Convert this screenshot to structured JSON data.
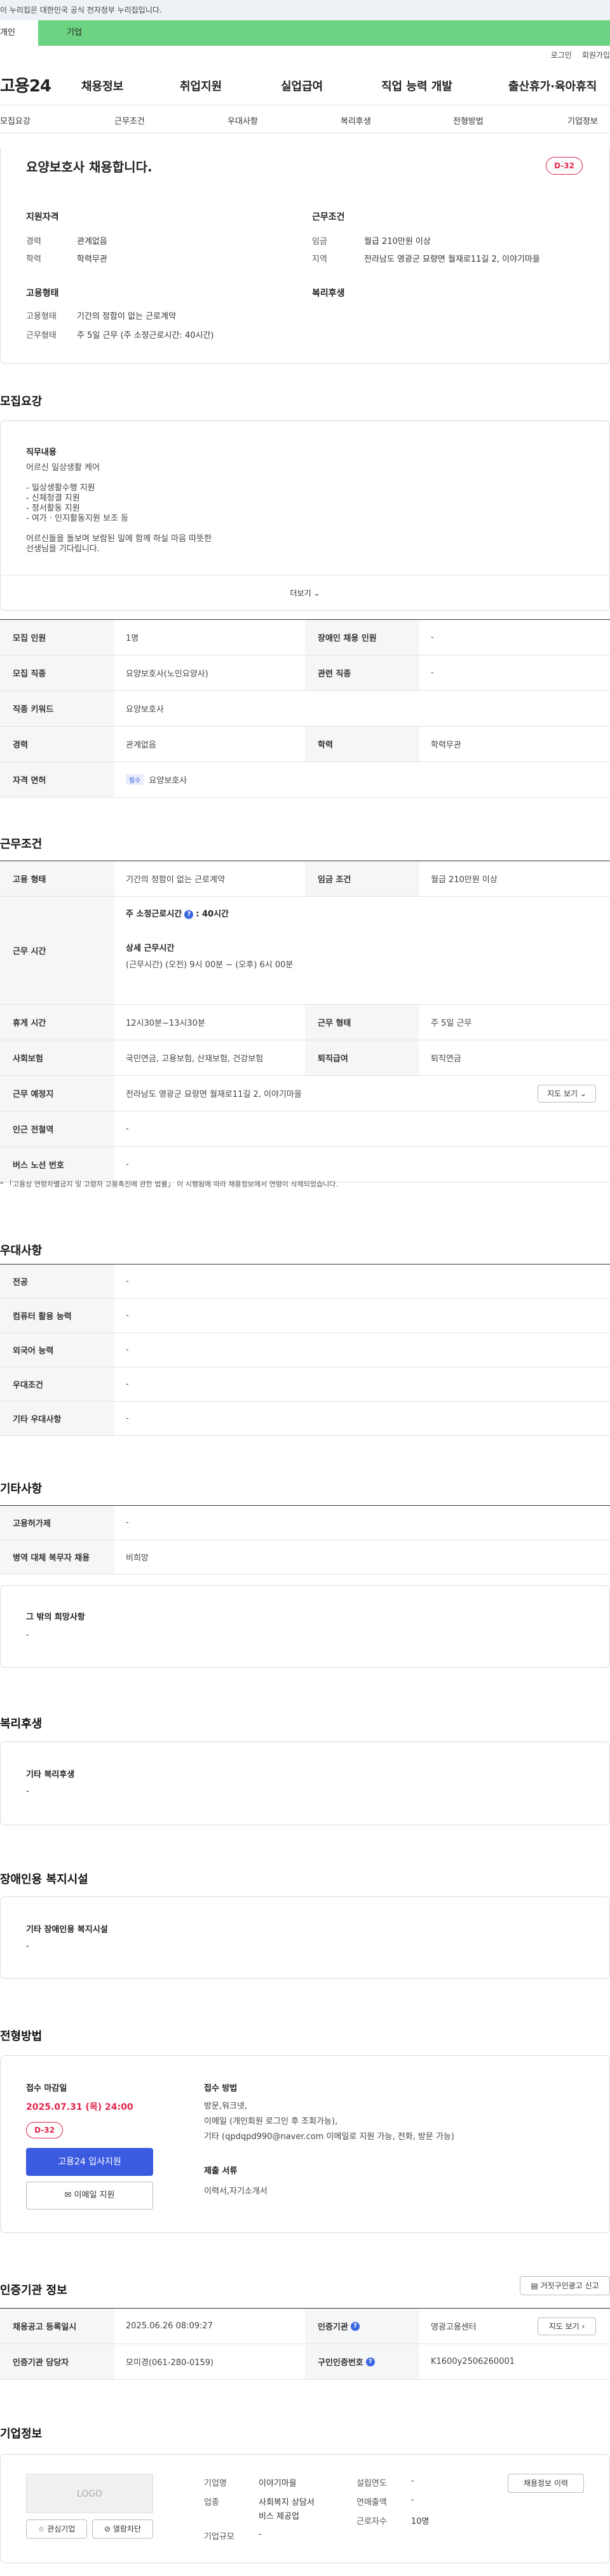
{
  "gov_notice": "이 누리집은 대한민국 공식 전자정부 누리집입니다.",
  "top_tabs": [
    "개인",
    "기업"
  ],
  "util_links": [
    "로그인",
    "회원가입"
  ],
  "logo": "고용24",
  "gnb": [
    "채용정보",
    "취업지원",
    "실업급여",
    "직업 능력 개발",
    "출산휴가·육아휴직"
  ],
  "subnav": [
    "모집요강",
    "근무조건",
    "우대사항",
    "복리후생",
    "전형방법",
    "기업정보"
  ],
  "header": {
    "title": "요양보호사 채용합니다.",
    "dday": "D-32",
    "qual_title": "지원자격",
    "cond_title": "근무조건",
    "career_label": "경력",
    "career_value": "관계없음",
    "edu_label": "학력",
    "edu_value": "학력무관",
    "wage_label": "임금",
    "wage_value": "월급 210만원 이상",
    "region_label": "지역",
    "region_value": "전라남도 영광군 묘량면 월재로11길 2, 이야기마을",
    "emp_title": "고용형태",
    "welfare_title": "복리후생",
    "emptype_label": "고용형태",
    "emptype_value": "기간의 정함이 없는 근로계약",
    "worktype_label": "근무형태",
    "worktype_value": "주 5일 근무 (주 소정근로시간: 40시간)"
  },
  "recruit": {
    "section_title": "모집요강",
    "duty_title": "직무내용",
    "duty_lines": [
      "어르신 일상생활 케어",
      "",
      "- 일상생활수행 지원",
      "- 신체청결 지원",
      "- 정서활동 지원",
      "- 여가 · 인지활동지원 보조 등",
      "",
      "어르신들을 돌보며 보람된 일에 함께 하실 마음 따뜻한",
      "선생님을 기다립니다."
    ],
    "more": "더보기",
    "rows": [
      {
        "th1": "모집 인원",
        "td1": "1명",
        "th2": "장애인 채용 인원",
        "td2": "-"
      },
      {
        "th1": "모집 직종",
        "td1": "요양보호사(노인요양사)",
        "th2": "관련 직종",
        "td2": "-"
      },
      {
        "th1": "직종 키워드",
        "td1": "요양보호사"
      },
      {
        "th1": "경력",
        "td1": "관계없음",
        "th2": "학력",
        "td2": "학력무관"
      },
      {
        "th1": "자격 면허",
        "chip": "필수",
        "td1": "요양보호사"
      }
    ]
  },
  "work": {
    "section_title": "근무조건",
    "emp_th": "고용 형태",
    "emp_td": "기간의 정함이 없는 근로계약",
    "wage_th": "임금 조건",
    "wage_td": "월급 210만원 이상",
    "hours_th": "근무 시간",
    "hours_weekly_label": "주 소정근로시간",
    "hours_weekly_value": ": 40시간",
    "hours_detail_title": "상세 근무시간",
    "hours_detail": "(근무시간) (오전) 9시 00분 ~ (오후) 6시 00분",
    "break_th": "휴게 시간",
    "break_td": "12시30분~13시30분",
    "form_th": "근무 형태",
    "form_td": "주 5일 근무",
    "ins_th": "사회보험",
    "ins_td": "국민연금, 고용보험, 산재보험, 건강보험",
    "sev_th": "퇴직급여",
    "sev_td": "퇴직연금",
    "place_th": "근무 예정지",
    "place_td": "전라남도 영광군 묘량면 월재로11길 2, 이야기마을",
    "map_btn": "지도 보기",
    "subway_th": "인근 전철역",
    "subway_td": "-",
    "bus_th": "버스 노선 번호",
    "bus_td": "-",
    "notice": "* 「고용상 연령차별금지 및 고령자 고용촉진에 관한 법률」 이 시행됨에 따라 채용정보에서 연령이 삭제되었습니다."
  },
  "pref": {
    "section_title": "우대사항",
    "rows": [
      [
        "전공",
        "-"
      ],
      [
        "컴퓨터 활용 능력",
        "-"
      ],
      [
        "외국어 능력",
        "-"
      ],
      [
        "우대조건",
        "-"
      ],
      [
        "기타 우대사항",
        "-"
      ]
    ]
  },
  "etc": {
    "section_title": "기타사항",
    "rows": [
      [
        "고용허가제",
        "-"
      ],
      [
        "병역 대체 복무자 채용",
        "비희망"
      ]
    ],
    "box_title": "그 밖의 희망사항",
    "box_value": "-"
  },
  "welfare": {
    "section_title": "복리후생",
    "box_title": "기타 복리후생",
    "box_value": "-"
  },
  "disabled": {
    "section_title": "장애인용 복지시설",
    "box_title": "기타 장애인용 복지시설",
    "box_value": "-"
  },
  "apply": {
    "section_title": "전형방법",
    "deadline_title": "접수 마감일",
    "deadline": "2025.07.31 (목) 24:00",
    "dday": "D-32",
    "apply_btn": "고용24 입사지원",
    "email_btn": "이메일 지원",
    "method_title": "접수 방법",
    "methods": [
      "방문,워크넷,",
      "이메일 (개인회원 로그인 후 조회가능),",
      "기타 (qpdqpd990@naver.com 이메일로 지원 가능, 전화, 방문 가능)"
    ],
    "docs_title": "제출 서류",
    "docs": "이력서,자기소개서"
  },
  "agency": {
    "section_title": "인증기관 정보",
    "report_btn": "거짓구인광고 신고",
    "reg_th": "채용공고 등록일시",
    "reg_td": "2025.06.26 08:09:27",
    "org_th": "인증기관",
    "org_td": "영광고용센터",
    "map_btn": "지도 보기",
    "mgr_th": "인증기관 담당자",
    "mgr_td": "모미경(061-280-0159)",
    "id_th": "구인인증번호",
    "id_td": "K1600y2506260001"
  },
  "company": {
    "section_title": "기업정보",
    "logo_text": "LOGO",
    "fav_btn": "관심기업",
    "block_btn": "열람차단",
    "name_label": "기업명",
    "name_value": "이야기마을",
    "ind_label": "업종",
    "ind_value1": "사회복지 상담서",
    "ind_value2": "비스 제공업",
    "size_label": "기업규모",
    "size_value": "-",
    "est_label": "설립연도",
    "est_value": "-",
    "sales_label": "연매출액",
    "sales_value": "-",
    "emp_label": "근로자수",
    "emp_value": "10명",
    "jobs_btn": "채용정보 이력"
  },
  "colors": {
    "accent": "#3b5be0",
    "dday": "#e1264b",
    "tab_green": "#6cd383"
  }
}
